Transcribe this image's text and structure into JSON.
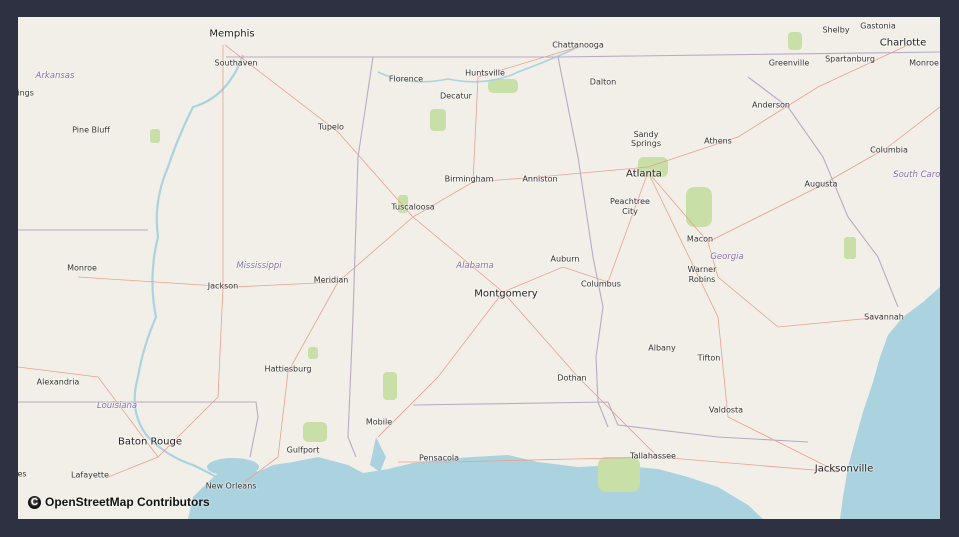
{
  "attribution": {
    "icon": "copyright-icon",
    "symbol": "C",
    "text": "OpenStreetMap Contributors"
  },
  "colors": {
    "land": "#f2efe9",
    "water": "#aad3df",
    "border": "#b9a9c6",
    "roads": "#e8a08e",
    "green": "#c8dfa8"
  },
  "cities_major": [
    {
      "id": "memphis",
      "name": "Memphis"
    },
    {
      "id": "atlanta",
      "name": "Atlanta"
    },
    {
      "id": "montgomery",
      "name": "Montgomery"
    },
    {
      "id": "charlotte",
      "name": "Charlotte"
    },
    {
      "id": "jacksonville",
      "name": "Jacksonville"
    },
    {
      "id": "baton-rouge",
      "name": "Baton Rouge"
    }
  ],
  "cities": [
    {
      "id": "southaven",
      "name": "Southaven"
    },
    {
      "id": "chattanooga",
      "name": "Chattanooga"
    },
    {
      "id": "shelby",
      "name": "Shelby"
    },
    {
      "id": "gastonia",
      "name": "Gastonia"
    },
    {
      "id": "greenville",
      "name": "Greenville"
    },
    {
      "id": "spartanburg",
      "name": "Spartanburg"
    },
    {
      "id": "monroe-nc",
      "name": "Monroe"
    },
    {
      "id": "florence",
      "name": "Florence"
    },
    {
      "id": "huntsville",
      "name": "Huntsville"
    },
    {
      "id": "decatur",
      "name": "Decatur"
    },
    {
      "id": "dalton",
      "name": "Dalton"
    },
    {
      "id": "anderson",
      "name": "Anderson"
    },
    {
      "id": "pine-bluff",
      "name": "Pine Bluff"
    },
    {
      "id": "tupelo",
      "name": "Tupelo"
    },
    {
      "id": "sandy-springs",
      "name": "Sandy Springs"
    },
    {
      "id": "athens",
      "name": "Athens"
    },
    {
      "id": "columbia",
      "name": "Columbia"
    },
    {
      "id": "birmingham",
      "name": "Birmingham"
    },
    {
      "id": "anniston",
      "name": "Anniston"
    },
    {
      "id": "augusta",
      "name": "Augusta"
    },
    {
      "id": "tuscaloosa",
      "name": "Tuscaloosa"
    },
    {
      "id": "peachtree-city",
      "name": "Peachtree City"
    },
    {
      "id": "macon",
      "name": "Macon"
    },
    {
      "id": "monroe-la",
      "name": "Monroe"
    },
    {
      "id": "jackson",
      "name": "Jackson"
    },
    {
      "id": "meridian",
      "name": "Meridian"
    },
    {
      "id": "auburn",
      "name": "Auburn"
    },
    {
      "id": "columbus",
      "name": "Columbus"
    },
    {
      "id": "warner-robins",
      "name": "Warner Robins"
    },
    {
      "id": "savannah",
      "name": "Savannah"
    },
    {
      "id": "albany",
      "name": "Albany"
    },
    {
      "id": "tifton",
      "name": "Tifton"
    },
    {
      "id": "alexandria",
      "name": "Alexandria"
    },
    {
      "id": "hattiesburg",
      "name": "Hattiesburg"
    },
    {
      "id": "dothan",
      "name": "Dothan"
    },
    {
      "id": "valdosta",
      "name": "Valdosta"
    },
    {
      "id": "mobile",
      "name": "Mobile"
    },
    {
      "id": "gulfport",
      "name": "Gulfport"
    },
    {
      "id": "pensacola",
      "name": "Pensacola"
    },
    {
      "id": "tallahassee",
      "name": "Tallahassee"
    },
    {
      "id": "lafayette",
      "name": "Lafayette"
    },
    {
      "id": "new-orleans",
      "name": "New Orleans"
    },
    {
      "id": "springs-partial",
      "name": "rings"
    },
    {
      "id": "es-partial",
      "name": "es"
    }
  ],
  "states": [
    {
      "id": "arkansas",
      "name": "Arkansas"
    },
    {
      "id": "mississippi",
      "name": "Mississippi"
    },
    {
      "id": "alabama",
      "name": "Alabama"
    },
    {
      "id": "georgia",
      "name": "Georgia"
    },
    {
      "id": "south-carolina",
      "name": "South Carol"
    },
    {
      "id": "louisiana",
      "name": "Louisiana"
    }
  ]
}
